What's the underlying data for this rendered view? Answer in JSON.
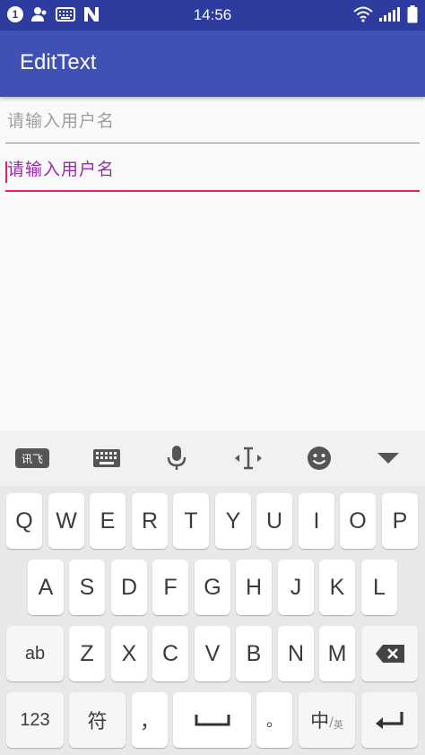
{
  "status_bar": {
    "notification_count": "1",
    "time": "14:56",
    "icons": [
      "contacts-icon",
      "keyboard-notify-icon",
      "n-logo-icon",
      "wifi-icon",
      "signal-icon",
      "battery-icon"
    ]
  },
  "app_bar": {
    "title": "EditText",
    "color": "#3f51b5"
  },
  "edit_texts": [
    {
      "hint": "请输入用户名",
      "focused": false
    },
    {
      "hint": "请输入用户名",
      "focused": true,
      "accent": "#e91e63",
      "hint_color": "#9c27b0"
    }
  ],
  "keyboard": {
    "toolbar": {
      "logo_label": "讯飞",
      "icons": [
        "keyboard-icon",
        "microphone-icon",
        "cursor-move-icon",
        "emoji-icon",
        "collapse-triangle-icon"
      ]
    },
    "row1": [
      "Q",
      "W",
      "E",
      "R",
      "T",
      "Y",
      "U",
      "I",
      "O",
      "P"
    ],
    "row2": [
      "A",
      "S",
      "D",
      "F",
      "G",
      "H",
      "J",
      "K",
      "L"
    ],
    "row3": {
      "shift_label": "ab",
      "letters": [
        "Z",
        "X",
        "C",
        "V",
        "B",
        "N",
        "M"
      ]
    },
    "row4": {
      "num_label": "123",
      "symbol_label": "符",
      "comma_label": "，",
      "period_label": "。",
      "lang_main": "中",
      "lang_sep": "/",
      "lang_sub": "英"
    }
  }
}
